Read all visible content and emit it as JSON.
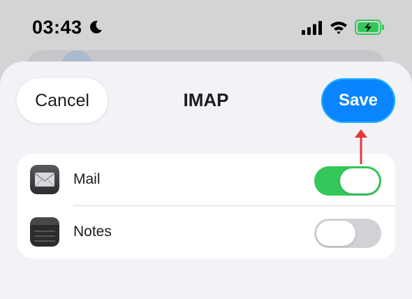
{
  "status_bar": {
    "time": "03:43",
    "icons": [
      "moon-icon",
      "cellular-signal-icon",
      "wifi-icon",
      "battery-charging-icon"
    ],
    "battery_color": "#34c759"
  },
  "nav": {
    "cancel_label": "Cancel",
    "title": "IMAP",
    "save_label": "Save"
  },
  "colors": {
    "accent": "#0a84ff",
    "toggle_on": "#34c759",
    "toggle_off": "#d1d1d6",
    "annotation_arrow": "#e5383b"
  },
  "settings": {
    "items": [
      {
        "label": "Mail",
        "icon": "mail-app-icon",
        "enabled": true
      },
      {
        "label": "Notes",
        "icon": "notes-app-icon",
        "enabled": false
      }
    ]
  }
}
